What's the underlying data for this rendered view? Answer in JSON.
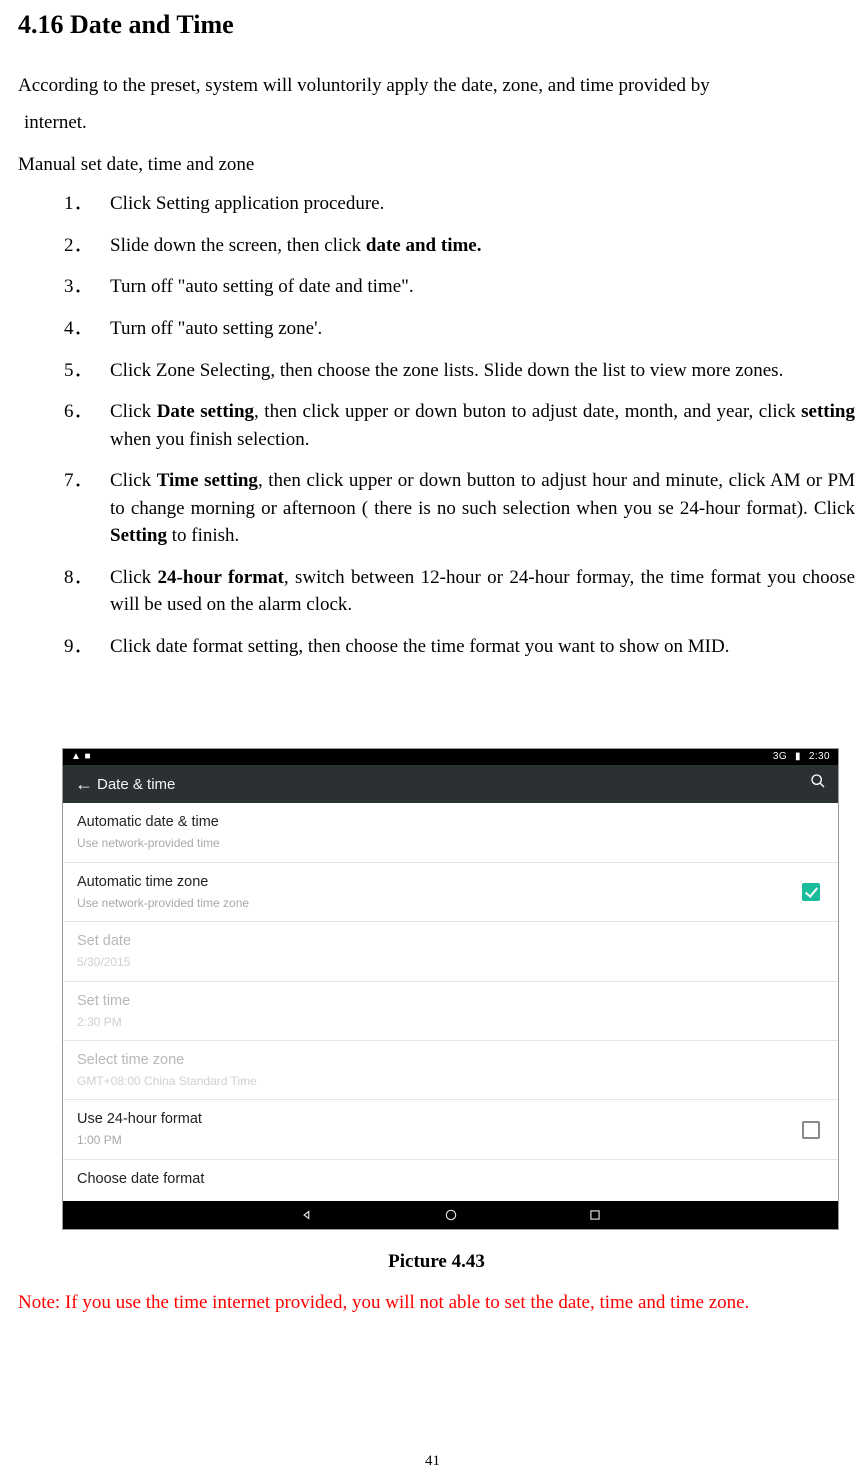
{
  "heading": "4.16 Date and Time",
  "intro_l1": "According to the preset, system will voluntorily apply the date, zone, and time provided by",
  "intro_l2": "internet.",
  "manual_heading": "Manual set date, time and zone",
  "steps": {
    "n1": "1．",
    "s1": "Click Setting application procedure.",
    "n2": "2．",
    "s2a": "Slide down the screen, then click ",
    "s2b": "date and time.",
    "n3": "3．",
    "s3": "Turn off \"auto setting of date and time\".",
    "n4": "4．",
    "s4": "Turn off \"auto setting zone'.",
    "n5": "5．",
    "s5": "Click Zone Selecting, then choose the zone lists. Slide down the list to view more zones.",
    "n6": "6．",
    "s6a": "Click ",
    "s6b": "Date setting",
    "s6c": ", then click upper or down buton to adjust date, month, and year, click ",
    "s6d": "setting",
    "s6e": " when you finish selection.",
    "n7": "7．",
    "s7a": "Click ",
    "s7b": "Time setting",
    "s7c": ", then click upper or down button to adjust hour and minute, click AM or PM to change morning or afternoon ( there is no such selection when you se 24-hour format). Click ",
    "s7d": "Setting",
    "s7e": " to finish.",
    "n8": "8．",
    "s8a": "Click ",
    "s8b": "24-hour format",
    "s8c": ", switch between 12-hour or 24-hour formay, the time format you choose will be used on the alarm clock.",
    "n9": "9．",
    "s9": "Click date format setting, then choose the time format you want to show on MID."
  },
  "caption": "Picture 4.43",
  "note": "Note: If you use the time internet provided, you will not able to set the date, time and time zone.",
  "pagenum": "41",
  "shot": {
    "status_left": "▲ ■",
    "status_3g": "3G",
    "status_batt": "▮",
    "status_time": "2:30",
    "appbar_title": "Date & time",
    "row1_t": "Automatic date & time",
    "row1_s": "Use network-provided time",
    "row2_t": "Automatic time zone",
    "row2_s": "Use network-provided time zone",
    "row3_t": "Set date",
    "row3_s": "5/30/2015",
    "row4_t": "Set time",
    "row4_s": "2:30 PM",
    "row5_t": "Select time zone",
    "row5_s": "GMT+08:00 China Standard Time",
    "row6_t": "Use 24-hour format",
    "row6_s": "1:00 PM",
    "row7_t": "Choose date format"
  }
}
